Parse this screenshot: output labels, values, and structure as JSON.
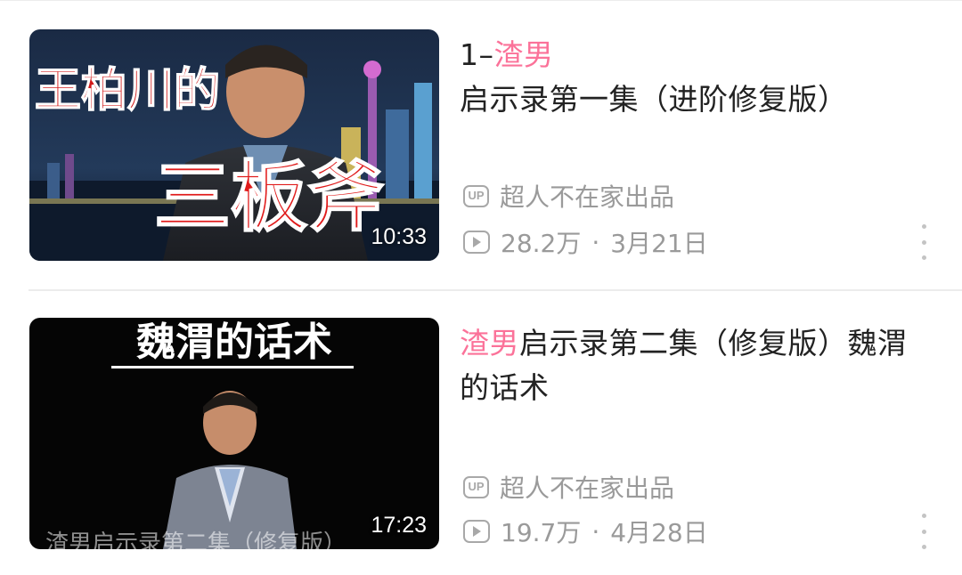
{
  "videos": [
    {
      "title_prefix": "1–",
      "title_highlight": "渣男",
      "title_rest": "启示录第一集（进阶修复版）",
      "duration": "10:33",
      "thumbnail_text_top": "王柏川的",
      "thumbnail_text_main": "三板斧",
      "uploader": "超人不在家出品",
      "views": "28.2万",
      "separator": "·",
      "date": "3月21日",
      "up_badge": "UP"
    },
    {
      "title_prefix": "",
      "title_highlight": "渣男",
      "title_rest": "启示录第二集（修复版）魏渭的话术",
      "duration": "17:23",
      "thumbnail_text_top": "魏渭的话术",
      "thumbnail_text_bottom": "渣男启示录第二集（修复版）",
      "uploader": "超人不在家出品",
      "views": "19.7万",
      "separator": "·",
      "date": "4月28日",
      "up_badge": "UP"
    }
  ],
  "colors": {
    "highlight": "#fb7299",
    "meta_gray": "#9a9a9a",
    "title_black": "#222222"
  }
}
